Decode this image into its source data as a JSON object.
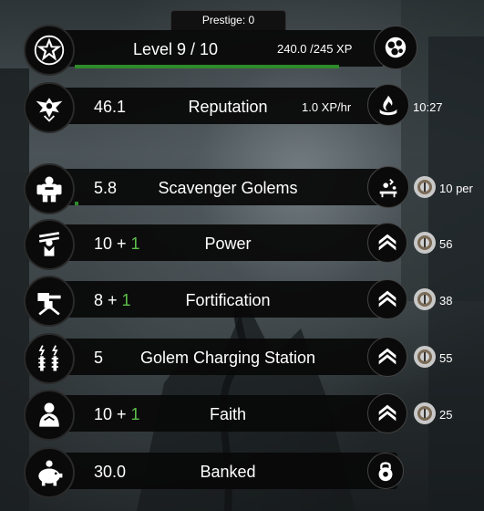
{
  "prestige": "Prestige: 0",
  "level": {
    "label": "Level 9 / 10",
    "xp": "240.0 /245 XP",
    "progress": 0.98
  },
  "reputation": {
    "value": "46.1",
    "label": "Reputation",
    "rate": "1.0 XP/hr",
    "timer": "10:27"
  },
  "golems": {
    "value": "5.8",
    "label": "Scavenger Golems",
    "cost": "10 per",
    "progress": 0.12
  },
  "stats": [
    {
      "base": "10",
      "sep": " + ",
      "bonus": "1",
      "label": "Power",
      "cost": "56"
    },
    {
      "base": "8",
      "sep": " + ",
      "bonus": "1",
      "label": "Fortification",
      "cost": "38"
    },
    {
      "base": "5",
      "sep": "",
      "bonus": "",
      "label": "Golem Charging Station",
      "cost": "55"
    },
    {
      "base": "10",
      "sep": " + ",
      "bonus": "1",
      "label": "Faith",
      "cost": "25"
    }
  ],
  "banked": {
    "value": "30.0",
    "label": "Banked"
  },
  "icons": {
    "level": "star-emblem-icon",
    "level_action": "orbs-icon",
    "reputation": "eagle-emblem-icon",
    "reputation_action": "flame-hand-icon",
    "golems": "golem-icon",
    "golems_action": "scavenge-icon",
    "power": "raised-fist-icon",
    "fortification": "turret-icon",
    "charging": "tesla-coil-icon",
    "faith": "praying-figure-icon",
    "banked": "piggy-bank-icon",
    "banked_action": "padlock-icon",
    "upgrade": "chevron-up-icon",
    "gear": "gear-coin-icon"
  },
  "colors": {
    "bonus": "#5cbf4a",
    "progress": "#2e8b2a"
  }
}
